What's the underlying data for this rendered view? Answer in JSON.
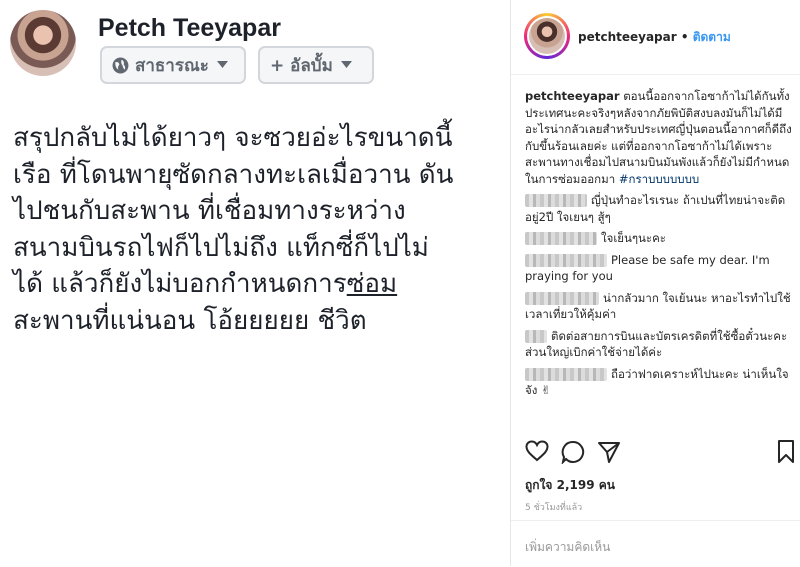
{
  "facebook": {
    "name": "Petch Teeyapar",
    "privacy_label": "สาธารณะ",
    "album_label": "+ อัลบั้ม",
    "post_lines": [
      "สรุปกลับไม่ได้ยาวๆ จะซวยอ่ะไรขนาดนี้",
      "เรือ ที่โดนพายุซัดกลางทะเลเมื่อวาน ดัน",
      "ไปชนกับสะพาน ที่เชื่อมทางระหว่าง",
      "สนามบินรถไฟก็ไปไม่ถึง แท็กซี่ก็ไปไม่",
      "ได้ แล้วก็ยังไม่บอกกำหนดการ",
      "ซ่อม",
      "สะพานที่แน่นอน โอ้ยยยยย ชีวิต"
    ]
  },
  "instagram": {
    "username": "petchteeyapar",
    "dot": "•",
    "follow_label": "ติดตาม",
    "caption_user": "petchteeyapar",
    "caption_text": "ตอนนี้ออกจากโอซาก้าไม่ได้กันทั้งประเทศนะคะจริงๆหลังจากภัยพิบัติสงบลงมันก็ไม่ได้มีอะไรน่ากลัวเลยสำหรับประเทศญี่ปุ่นตอนนี้อากาศก็ดีถึงกับขึ้นร้อนเลยค่ะ แต่ที่ออกจากโอซาก้าไม่ได้เพราะสะพานทางเชื่อมไปสนามบินมันพังแล้วก็ยังไม่มีกำหนดในการซ่อมออกมา",
    "hashtag": "#กราบบบบบบบ",
    "comments": [
      {
        "text": "ญี่ปุ่นทำอะไรเรนะ ถ้าเปนที่ไทยน่าจะติดอยู่2ปี ใจเยนๆ สู้ๆ"
      },
      {
        "text": "ใจเย็นๆนะคะ"
      },
      {
        "text": "Please be safe my dear. I'm praying for you"
      },
      {
        "text": "น่ากลัวมาก ใจเย้นนะ หาอะไรทำไปใช้เวลาเที่ยวให้คุ้มค่า"
      },
      {
        "text": "ติดต่อสายการบินและบัตรเครดิตที่ใช้ซื้อตั๋วนะคะ ส่วนใหญ่เบิกค่าใช้จ่ายได้ค่ะ"
      },
      {
        "text": "ถือว่าฟาดเคราะห์ไปนะคะ น่าเห็นใจจัง ✌"
      }
    ],
    "likes": "ถูกใจ 2,199 คน",
    "time": "5 ชั่วโมงที่แล้ว",
    "add_comment_placeholder": "เพิ่มความคิดเห็น"
  }
}
